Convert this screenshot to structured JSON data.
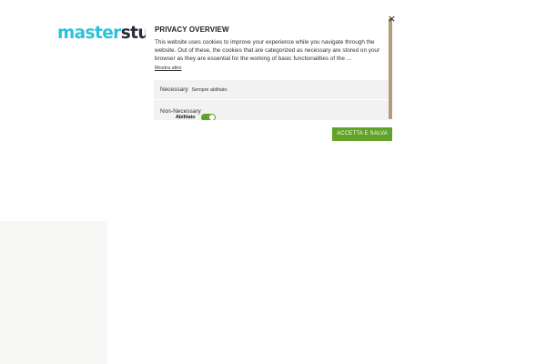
{
  "site": {
    "logo_part1": "master",
    "logo_part2": "studio"
  },
  "modal": {
    "title": "PRIVACY OVERVIEW",
    "close_icon": "×",
    "description": "This website uses cookies to improve your experience while you navigate through the website. Out of these, the cookies that are categorized as necessary are stored on your browser as they are essential for the working of basic functionalities of the ...",
    "show_more": "Mostra altro",
    "categories": [
      {
        "name": "Necessary",
        "status": "Sempre abilitato"
      },
      {
        "name": "Non-Necessary",
        "toggle_label": "Abilitato",
        "enabled": true
      }
    ],
    "accept_label": "ACCETTA E SALVA"
  },
  "colors": {
    "brand_cyan": "#2dc1d9",
    "brand_dark": "#2a2a3a",
    "accept_green": "#61a229",
    "scrollbar_thumb": "#b39b7a"
  },
  "icons": {
    "close": "close-icon"
  }
}
